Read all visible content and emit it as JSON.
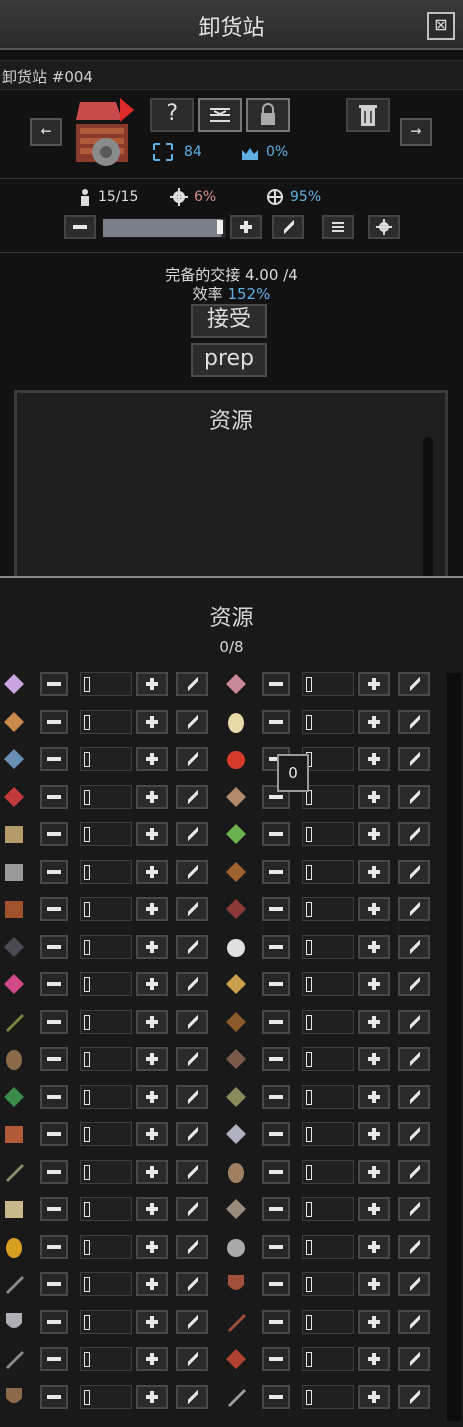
{
  "window": {
    "title": "卸货站",
    "close_glyph": "⊠"
  },
  "station_name": "卸货站 #004",
  "header_buttons": {
    "question_label": "?",
    "left_arrow": "←",
    "right_arrow": "→"
  },
  "stats": {
    "area": "84",
    "ownership": "0%",
    "workers": "15/15",
    "workload": "6%",
    "efficiency_pct": "95%"
  },
  "workforce_slider": {
    "fraction": 0.97
  },
  "delivery": {
    "label": "完备的交接",
    "value": "4.00",
    "max": "/4",
    "efficiency_label": "效率",
    "efficiency_value": "152%"
  },
  "buttons": {
    "accept": "接受",
    "prep": "prep"
  },
  "resources_top": {
    "title": "资源"
  },
  "resources": {
    "title": "资源",
    "count": "0/8",
    "tooltip_value": "0",
    "rows": [
      {
        "left": {
          "icon": "jar-icon",
          "color": "#c9a6e0"
        },
        "right": {
          "icon": "crown-icon",
          "color": "#c88a9a"
        }
      },
      {
        "left": {
          "icon": "bread-icon",
          "color": "#c98a4c"
        },
        "right": {
          "icon": "egg-icon",
          "color": "#e8d9a8"
        }
      },
      {
        "left": {
          "icon": "fish-icon",
          "color": "#6a8fb5"
        },
        "right": {
          "icon": "apple-icon",
          "color": "#d63b2b"
        }
      },
      {
        "left": {
          "icon": "meat-icon",
          "color": "#c23b3b"
        },
        "right": {
          "icon": "mushroom-icon",
          "color": "#b08a6a"
        }
      },
      {
        "left": {
          "icon": "crate-icon",
          "color": "#b59a6a"
        },
        "right": {
          "icon": "vegetable-icon",
          "color": "#6ab04c"
        }
      },
      {
        "left": {
          "icon": "stone-icon",
          "color": "#9a9a9a"
        },
        "right": {
          "icon": "wood-icon",
          "color": "#a0622d"
        }
      },
      {
        "left": {
          "icon": "cabinet-icon",
          "color": "#a0522d"
        },
        "right": {
          "icon": "brick-icon",
          "color": "#8b3a3a"
        }
      },
      {
        "left": {
          "icon": "coal-icon",
          "color": "#4a4a55"
        },
        "right": {
          "icon": "cotton-icon",
          "color": "#e0e0e0"
        }
      },
      {
        "left": {
          "icon": "gem-icon",
          "color": "#d04a8a"
        },
        "right": {
          "icon": "grain-icon",
          "color": "#c8a04a"
        }
      },
      {
        "left": {
          "icon": "herb-icon",
          "color": "#7a8a3a"
        },
        "right": {
          "icon": "leather-icon",
          "color": "#8a5a2a"
        }
      },
      {
        "left": {
          "icon": "sack-icon",
          "color": "#8a6a4a"
        },
        "right": {
          "icon": "ore-icon",
          "color": "#7a5a4a"
        }
      },
      {
        "left": {
          "icon": "leaves-icon",
          "color": "#3a8a4a"
        },
        "right": {
          "icon": "cloth-icon",
          "color": "#8a8a5a"
        }
      },
      {
        "left": {
          "icon": "furniture-icon",
          "color": "#b05a3a"
        },
        "right": {
          "icon": "metal-bar-icon",
          "color": "#b0b0c0"
        }
      },
      {
        "left": {
          "icon": "pipe-icon",
          "color": "#8a8a6a"
        },
        "right": {
          "icon": "pottery-icon",
          "color": "#a08060"
        }
      },
      {
        "left": {
          "icon": "block-icon",
          "color": "#c8b88a"
        },
        "right": {
          "icon": "coat-icon",
          "color": "#9a8a7a"
        }
      },
      {
        "left": {
          "icon": "ring-icon",
          "color": "#d8a020"
        },
        "right": {
          "icon": "gear-icon",
          "color": "#aaaaaa"
        }
      },
      {
        "left": {
          "icon": "tools-icon",
          "color": "#8a8a8a"
        },
        "right": {
          "icon": "armor-icon",
          "color": "#a0503a"
        }
      },
      {
        "left": {
          "icon": "steel-armor-icon",
          "color": "#b0b0b8"
        },
        "right": {
          "icon": "bow-icon",
          "color": "#a0503a"
        }
      },
      {
        "left": {
          "icon": "pickaxe-icon",
          "color": "#8a8a8a"
        },
        "right": {
          "icon": "map-icon",
          "color": "#b04030"
        }
      },
      {
        "left": {
          "icon": "shield-icon",
          "color": "#8a6a4a"
        },
        "right": {
          "icon": "dagger-icon",
          "color": "#9a9aa0"
        }
      }
    ]
  }
}
